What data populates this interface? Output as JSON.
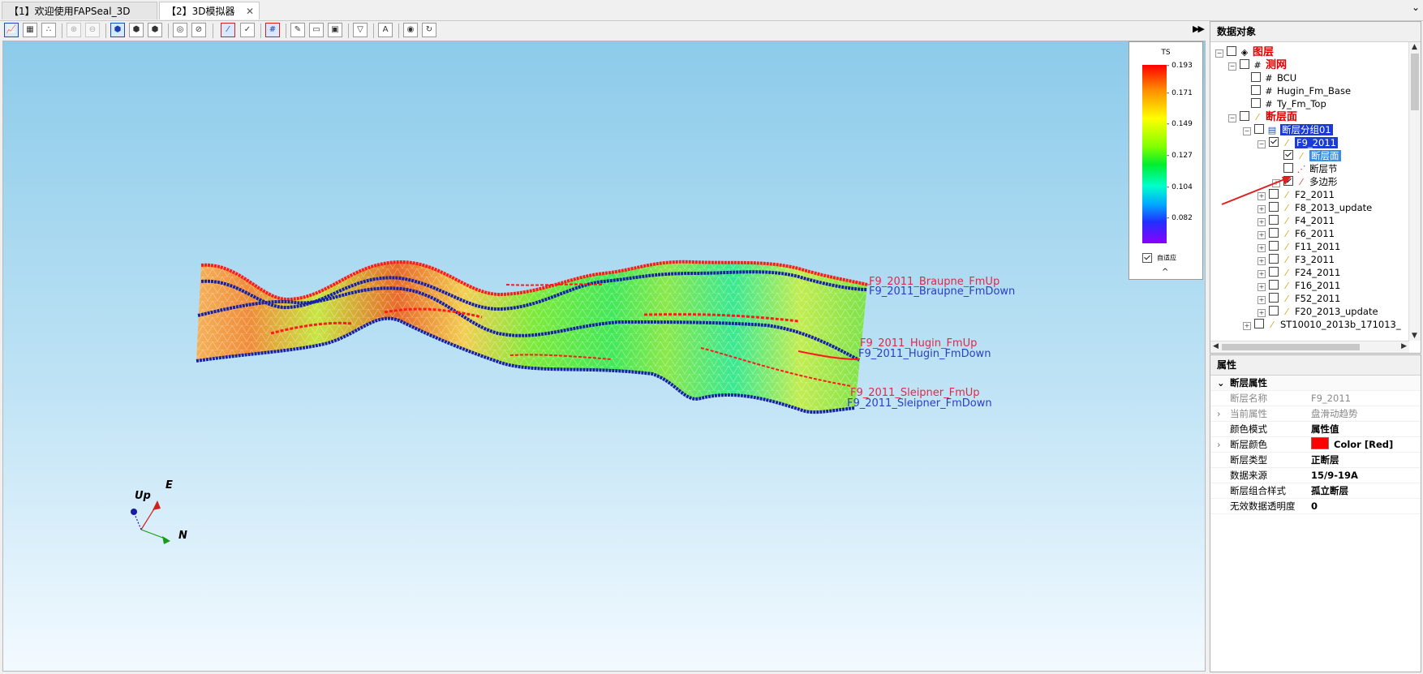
{
  "tabs": [
    {
      "label": "【1】欢迎使用FAPSeal_3D"
    },
    {
      "label": "【2】3D模拟器",
      "close": "✕"
    }
  ],
  "window_control": "⌄",
  "toolbar": {
    "icons": [
      "chart-icon",
      "grid-icon",
      "points-icon",
      "zoom-in-icon",
      "zoom-out-icon",
      "cube-icon",
      "cube-green-icon",
      "cube-red-icon",
      "eye-icon",
      "eye-off-icon",
      "fault-icon",
      "fault-check-icon",
      "mesh-icon",
      "pencil-icon",
      "folder-icon",
      "image-icon",
      "filter-icon",
      "text-icon",
      "camera-icon",
      "refresh-icon"
    ],
    "expand": "▶▶"
  },
  "legend": {
    "title": "TS",
    "ticks": [
      "0.193",
      "0.171",
      "0.149",
      "0.127",
      "0.104",
      "0.082"
    ],
    "auto_label": "自适应",
    "collapse": "^"
  },
  "fault_labels": [
    {
      "text": "F9_2011_Braupne_FmUp",
      "color": "red"
    },
    {
      "text": "F9_2011_Braupne_FmDown",
      "color": "blue"
    },
    {
      "text": "F9_2011_Hugin_FmUp",
      "color": "red"
    },
    {
      "text": "F9_2011_Hugin_FmDown",
      "color": "blue"
    },
    {
      "text": "F9_2011_Sleipner_FmUp",
      "color": "red"
    },
    {
      "text": "F9_2011_Sleipner_FmDown",
      "color": "blue"
    }
  ],
  "axes": {
    "up": "Up",
    "e": "E",
    "n": "N"
  },
  "data_panel": {
    "title": "数据对象",
    "tree": [
      {
        "label": "图层",
        "level": 0,
        "checked": false
      },
      {
        "label": "测网",
        "level": 1,
        "checked": false
      },
      {
        "label": "BCU",
        "level": 2,
        "checked": false
      },
      {
        "label": "Hugin_Fm_Base",
        "level": 2,
        "checked": false
      },
      {
        "label": "Ty_Fm_Top",
        "level": 2,
        "checked": false
      },
      {
        "label": "断层面",
        "level": 1,
        "checked": false
      },
      {
        "label": "断层分组01",
        "level": 2,
        "checked": false
      },
      {
        "label": "F9_2011",
        "level": 3,
        "checked": true
      },
      {
        "label": "断层面",
        "level": 4,
        "checked": true
      },
      {
        "label": "断层节",
        "level": 4,
        "checked": false
      },
      {
        "label": "多边形",
        "level": 4,
        "checked": true
      },
      {
        "label": "F2_2011",
        "level": 3,
        "checked": false
      },
      {
        "label": "F8_2013_update",
        "level": 3,
        "checked": false
      },
      {
        "label": "F4_2011",
        "level": 3,
        "checked": false
      },
      {
        "label": "F6_2011",
        "level": 3,
        "checked": false
      },
      {
        "label": "F11_2011",
        "level": 3,
        "checked": false
      },
      {
        "label": "F3_2011",
        "level": 3,
        "checked": false
      },
      {
        "label": "F24_2011",
        "level": 3,
        "checked": false
      },
      {
        "label": "F16_2011",
        "level": 3,
        "checked": false
      },
      {
        "label": "F52_2011",
        "level": 3,
        "checked": false
      },
      {
        "label": "F20_2013_update",
        "level": 3,
        "checked": false
      },
      {
        "label": "ST10010_2013b_171013_",
        "level": 2,
        "checked": false
      }
    ]
  },
  "properties": {
    "title": "属性",
    "category": "断层属性",
    "rows": [
      {
        "key": "断层名称",
        "value": "F9_2011",
        "muted": true
      },
      {
        "key": "当前属性",
        "value": "盘滑动趋势",
        "muted": true
      },
      {
        "key": "颜色模式",
        "value": "属性值"
      },
      {
        "key": "断层颜色",
        "value": "Color [Red]",
        "swatch": "#ff0000"
      },
      {
        "key": "断层类型",
        "value": "正断层"
      },
      {
        "key": "数据来源",
        "value": "15/9-19A"
      },
      {
        "key": "断层组合样式",
        "value": "孤立断层"
      },
      {
        "key": "无效数据透明度",
        "value": "0"
      }
    ]
  }
}
